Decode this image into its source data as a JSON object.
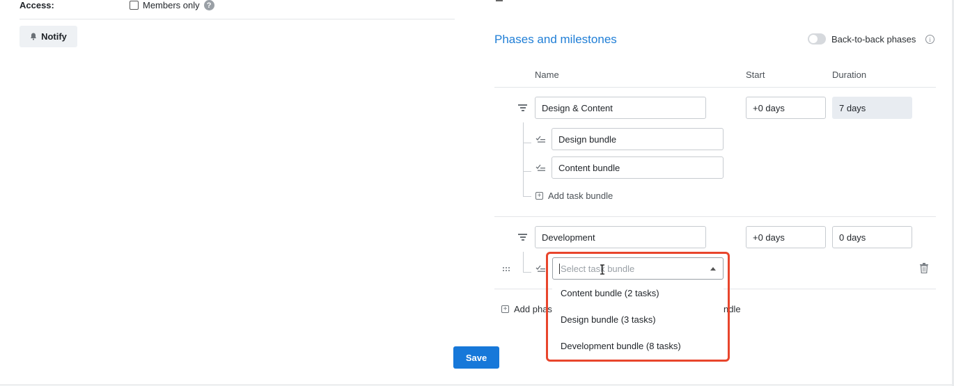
{
  "access": {
    "label": "Access:",
    "members_only_label": "Members only",
    "members_only_checked": false,
    "help_glyph": "?"
  },
  "notify": {
    "label": "Notify",
    "icon": "bell-icon"
  },
  "phases": {
    "title": "Phases and milestones",
    "back_to_back_label": "Back-to-back phases",
    "back_to_back_enabled": false,
    "info_glyph": "i",
    "columns": {
      "name": "Name",
      "start": "Start",
      "duration": "Duration"
    },
    "list": [
      {
        "name": "Design & Content",
        "start": "+0 days",
        "duration": "7 days",
        "bundles": [
          "Design bundle",
          "Content bundle"
        ],
        "add_bundle_label": "Add task bundle"
      },
      {
        "name": "Development",
        "start": "+0 days",
        "duration": "0 days",
        "select_placeholder": "Select task bundle"
      }
    ],
    "add_phase_label": "Add phas",
    "add_end_fragment": "ndle"
  },
  "dropdown": {
    "options": [
      "Content bundle (2 tasks)",
      "Design bundle (3 tasks)",
      "Development bundle (8 tasks)"
    ]
  },
  "save_label": "Save",
  "colors": {
    "accent": "#1778d9",
    "title": "#1f7ed6",
    "highlight": "#e8452c"
  }
}
